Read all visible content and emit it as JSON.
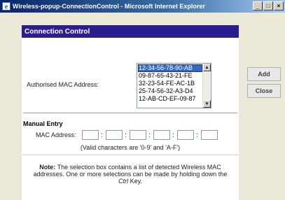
{
  "window": {
    "title": "Wireless-popup-ConnectionControl - Microsoft Internet Explorer",
    "minimize": "_",
    "maximize": "□",
    "close": "×"
  },
  "panel": {
    "header": "Connection Control",
    "authorised_label": "Authorised MAC Address:",
    "mac_addresses": [
      "12-34-56-78-90-AB",
      "09-87-65-43-21-FE",
      "32-23-54-FE-AC-1B",
      "25-74-56-32-A3-D4",
      "12-AB-CD-EF-09-87"
    ],
    "selected_index": 0,
    "manual_entry_title": "Manual Entry",
    "mac_address_label": "MAC Address:",
    "octet_values": [
      "",
      "",
      "",
      "",
      "",
      ""
    ],
    "separator": ":",
    "valid_chars_note": "(Valid characters are '0-9' and 'A-F')"
  },
  "note": {
    "label": "Note:",
    "text_before_key": " The selection box contains a list of detected Wireless MAC addresses. One or more selections can be made by holding down the ",
    "key": "Ctrl",
    "text_after_key": " Key."
  },
  "buttons": {
    "add": "Add",
    "close": "Close"
  },
  "colors": {
    "header_bg": "#2a1e8e",
    "selection_bg": "#316ac5",
    "title_bar": "#0a246a"
  }
}
